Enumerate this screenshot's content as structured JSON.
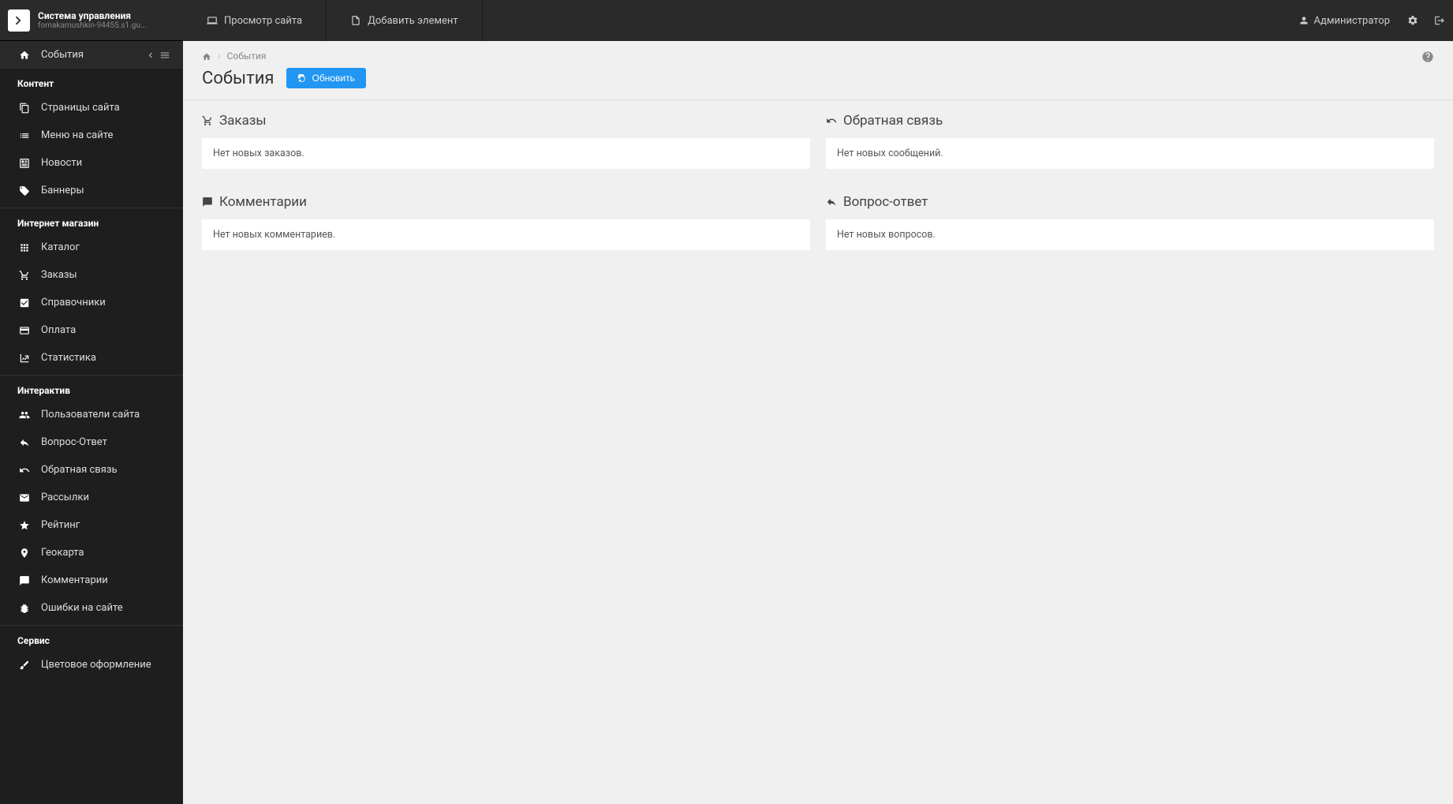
{
  "brand": {
    "title": "Система управления",
    "subtitle": "fomakamushkin-94455.s1.gu..."
  },
  "topbar": {
    "view_site": "Просмотр сайта",
    "add_element": "Добавить элемент",
    "user": "Администратор"
  },
  "sidebar": {
    "active": {
      "label": "События"
    },
    "sections": [
      {
        "title": "Контент",
        "items": [
          {
            "icon": "copy",
            "label": "Страницы сайта"
          },
          {
            "icon": "list",
            "label": "Меню на сайте"
          },
          {
            "icon": "news",
            "label": "Новости"
          },
          {
            "icon": "tag",
            "label": "Баннеры"
          }
        ]
      },
      {
        "title": "Интернет магазин",
        "items": [
          {
            "icon": "grid",
            "label": "Каталог"
          },
          {
            "icon": "cart",
            "label": "Заказы"
          },
          {
            "icon": "check",
            "label": "Справочники"
          },
          {
            "icon": "card",
            "label": "Оплата"
          },
          {
            "icon": "chart",
            "label": "Статистика"
          }
        ]
      },
      {
        "title": "Интерактив",
        "items": [
          {
            "icon": "users",
            "label": "Пользователи сайта"
          },
          {
            "icon": "reply",
            "label": "Вопрос-Ответ"
          },
          {
            "icon": "undo",
            "label": "Обратная связь"
          },
          {
            "icon": "mail",
            "label": "Рассылки"
          },
          {
            "icon": "star",
            "label": "Рейтинг"
          },
          {
            "icon": "pin",
            "label": "Геокарта"
          },
          {
            "icon": "comment",
            "label": "Комментарии"
          },
          {
            "icon": "bug",
            "label": "Ошибки на сайте"
          }
        ]
      },
      {
        "title": "Сервис",
        "items": [
          {
            "icon": "brush",
            "label": "Цветовое оформление"
          }
        ]
      }
    ]
  },
  "breadcrumb": {
    "current": "События"
  },
  "page": {
    "title": "События",
    "refresh": "Обновить"
  },
  "panels": {
    "orders": {
      "title": "Заказы",
      "body": "Нет новых заказов."
    },
    "feedback": {
      "title": "Обратная связь",
      "body": "Нет новых сообщений."
    },
    "comments": {
      "title": "Комментарии",
      "body": "Нет новых комментариев."
    },
    "qa": {
      "title": "Вопрос-ответ",
      "body": "Нет новых вопросов."
    }
  }
}
